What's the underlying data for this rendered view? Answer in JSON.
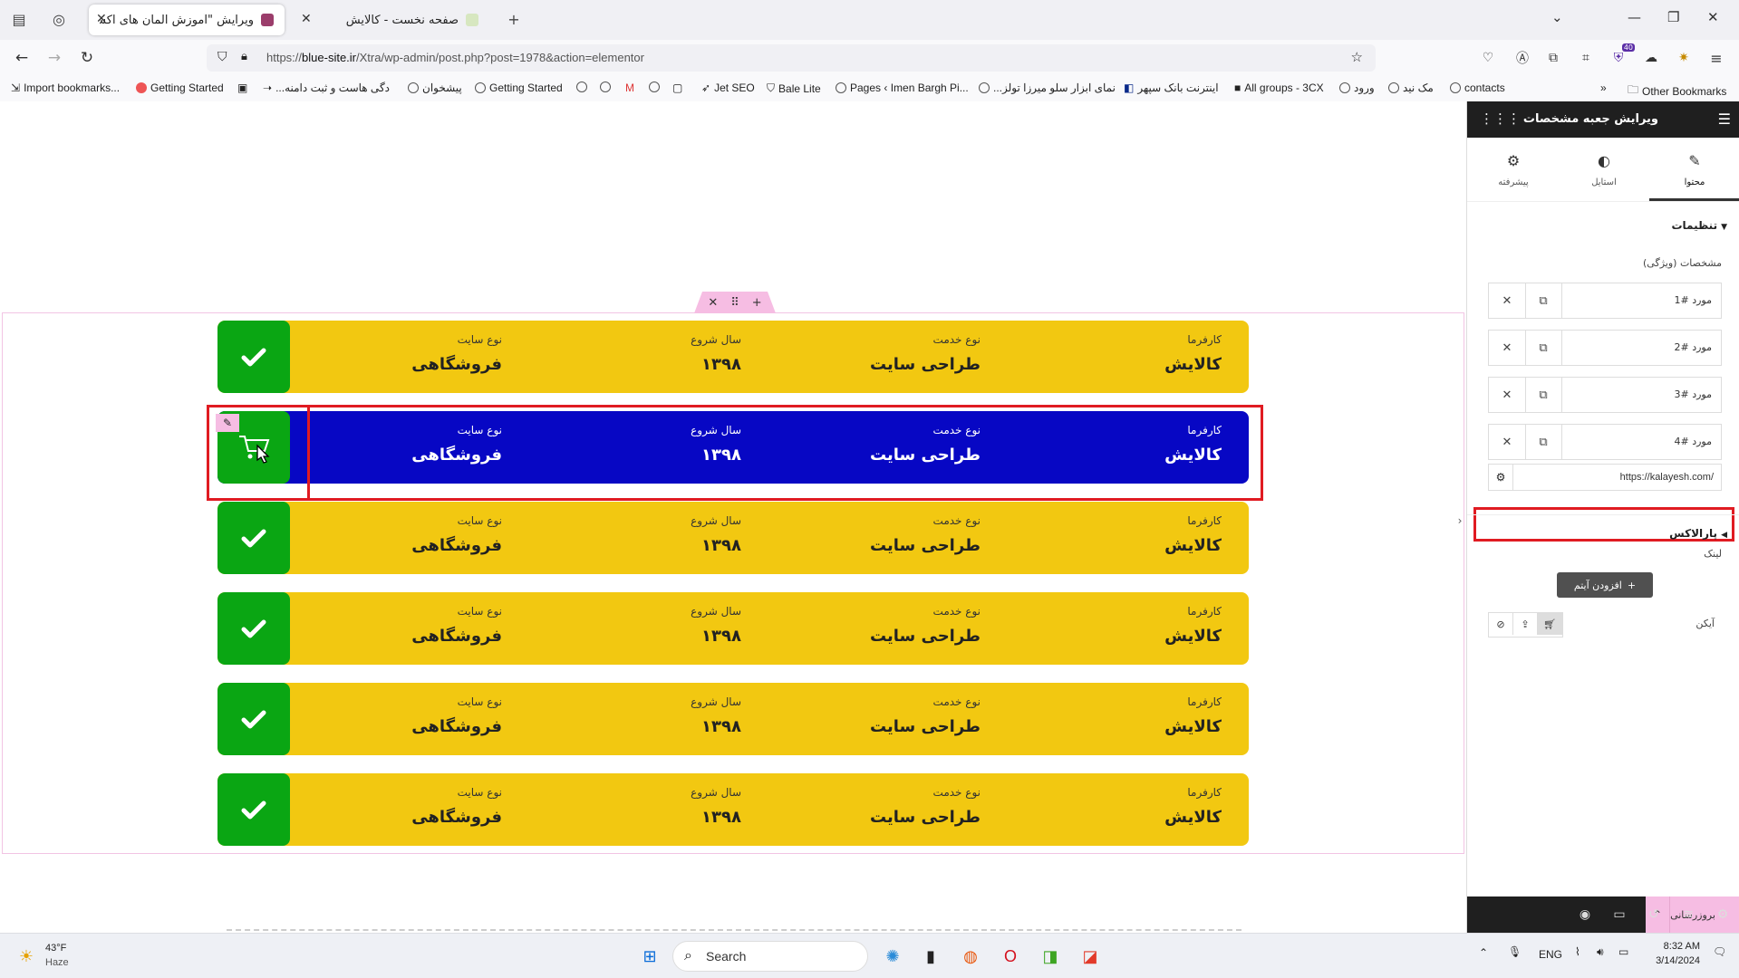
{
  "browser": {
    "tabs": [
      {
        "title": "ویرایش \"آموزش المان های اکسترا - ..."
      },
      {
        "title": "صفحه نخست - کالایش"
      }
    ],
    "url_prefix": "https://",
    "url_host": "blue-site.ir",
    "url_path": "/Xtra/wp-admin/post.php?post=1978&action=elementor",
    "extension_badge": "40",
    "bookmarks": [
      "Import bookmarks...",
      "Getting Started",
      "...دگی هاست و ثبت دامنه",
      "پیشخوان",
      "Getting Started",
      "Jet SEO",
      "Bale Lite",
      "Pages ‹ Imen Bargh Pi...",
      "...نمای ابزار سلو میرزا تولز",
      "اینترنت بانک سپهر",
      "All groups - 3CX",
      "ورود",
      "مک نید",
      "contacts"
    ],
    "other_bookmarks": "Other Bookmarks"
  },
  "canvas": {
    "rows": [
      {
        "client_label": "کارفرما",
        "client": "کالایش",
        "service_label": "نوع خدمت",
        "service": "طراحی سایت",
        "year_label": "سال شروع",
        "year": "۱۳۹۸",
        "type_label": "نوع سایت",
        "type": "فروشگاهی",
        "icon": "check-icon",
        "highlighted": false
      },
      {
        "client_label": "کارفرما",
        "client": "کالایش",
        "service_label": "نوع خدمت",
        "service": "طراحی سایت",
        "year_label": "سال شروع",
        "year": "۱۳۹۸",
        "type_label": "نوع سایت",
        "type": "فروشگاهی",
        "icon": "cart-icon",
        "highlighted": true
      },
      {
        "client_label": "کارفرما",
        "client": "کالایش",
        "service_label": "نوع خدمت",
        "service": "طراحی سایت",
        "year_label": "سال شروع",
        "year": "۱۳۹۸",
        "type_label": "نوع سایت",
        "type": "فروشگاهی",
        "icon": "check-icon",
        "highlighted": false
      },
      {
        "client_label": "کارفرما",
        "client": "کالایش",
        "service_label": "نوع خدمت",
        "service": "طراحی سایت",
        "year_label": "سال شروع",
        "year": "۱۳۹۸",
        "type_label": "نوع سایت",
        "type": "فروشگاهی",
        "icon": "check-icon",
        "highlighted": false
      },
      {
        "client_label": "کارفرما",
        "client": "کالایش",
        "service_label": "نوع خدمت",
        "service": "طراحی سایت",
        "year_label": "سال شروع",
        "year": "۱۳۹۸",
        "type_label": "نوع سایت",
        "type": "فروشگاهی",
        "icon": "check-icon",
        "highlighted": false
      },
      {
        "client_label": "کارفرما",
        "client": "کالایش",
        "service_label": "نوع خدمت",
        "service": "طراحی سایت",
        "year_label": "سال شروع",
        "year": "۱۳۹۸",
        "type_label": "نوع سایت",
        "type": "فروشگاهی",
        "icon": "check-icon",
        "highlighted": false
      }
    ],
    "colors": {
      "row_bg": "#f2c811",
      "row_highlight_bg": "#0707c4",
      "icon_box": "#0aa613",
      "annotation": "#e01b22"
    }
  },
  "panel": {
    "title": "ویرایش جعبه مشخصات",
    "tabs": [
      {
        "label": "محتوا",
        "icon": "pencil-icon",
        "active": true
      },
      {
        "label": "استایل",
        "icon": "half-circle-icon",
        "active": false
      },
      {
        "label": "پیشرفته",
        "icon": "gear-icon",
        "active": false
      }
    ],
    "section_title": "تنظیمات",
    "features_label": "مشخصات (ویژگی)",
    "items": [
      "مورد #1",
      "مورد #2",
      "مورد #3",
      "مورد #4"
    ],
    "add_item_label": "افزودن آیتم",
    "icon_label": "آیکن",
    "link_label": "لینک",
    "link_value": "https://kalayesh.com/",
    "parallax_label": "پارالاکس",
    "update_label": "بروزرسانی"
  },
  "taskbar": {
    "weather_temp": "43°F",
    "weather_desc": "Haze",
    "search_placeholder": "Search",
    "lang": "ENG",
    "time": "8:32 AM",
    "date": "3/14/2024"
  }
}
